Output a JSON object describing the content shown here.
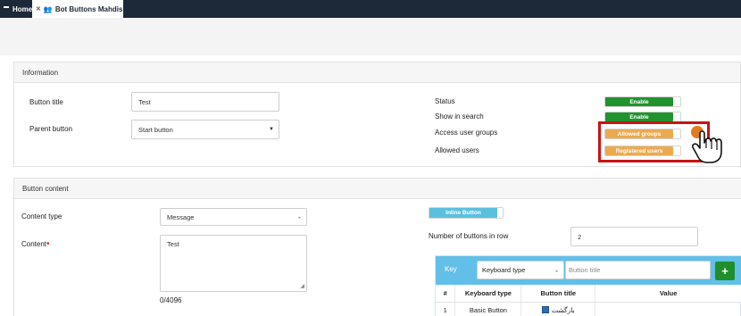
{
  "tabs": [
    {
      "label": "Home",
      "icon": "home-icon"
    },
    {
      "label": "Bot Buttons Mahdis",
      "icon": "people-icon",
      "active": true
    }
  ],
  "information": {
    "header": "Information",
    "button_title_label": "Button title",
    "button_title_value": "Test",
    "parent_button_label": "Parent button",
    "parent_button_value": "Start button",
    "status_label": "Status",
    "status_value": "Enable",
    "show_in_search_label": "Show in search",
    "show_in_search_value": "Enable",
    "access_user_groups_label": "Access user groups",
    "access_user_groups_value": "Allowed groups",
    "allowed_users_label": "Allowed users",
    "allowed_users_value": "Registered users"
  },
  "content": {
    "header": "Button content",
    "content_type_label": "Content type",
    "content_type_value": "Message",
    "content_label": "Content",
    "content_value": "Test",
    "char_count": "0/4096",
    "inline_button_label": "Inline Button",
    "buttons_in_row_label": "Number of buttons in row",
    "buttons_in_row_value": "2"
  },
  "keyboard": {
    "key_label": "Key",
    "type_select_value": "Keyboard type",
    "title_placeholder": "Button title",
    "add_label": "+",
    "columns": [
      "#",
      "Keyboard type",
      "Button title",
      "Value"
    ],
    "rows": [
      {
        "num": "1",
        "type": "Basic Button",
        "title": "بازگشت",
        "value": ""
      }
    ]
  },
  "colors": {
    "topbar": "#1d2839",
    "enable_green": "#21932e",
    "group_orange": "#ecaa4e",
    "inline_blue": "#5bc0de",
    "keyboard_header": "#62c0e8",
    "highlight_red": "#c91313"
  }
}
